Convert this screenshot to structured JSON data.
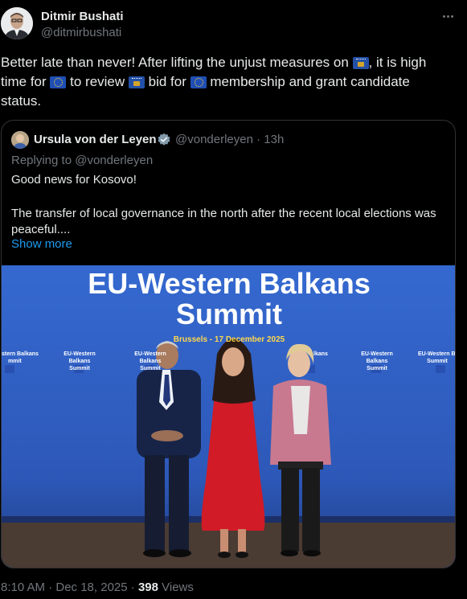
{
  "author": {
    "name": "Ditmir Bushati",
    "handle": "@ditmirbushati"
  },
  "tweet": {
    "part1": "Better late than never! After lifting the unjust measures on ",
    "part2": ", it is high time for ",
    "part3": " to review ",
    "part4": " bid for ",
    "part5": " membership and grant candidate status.",
    "flags": [
      "kosovo-flag",
      "eu-flag",
      "kosovo-flag",
      "eu-flag"
    ]
  },
  "quoted": {
    "name": "Ursula von der Leyen",
    "handle_time": "@vonderleyen · 13h",
    "replying": "Replying to @vonderleyen",
    "line1": "Good news for Kosovo!",
    "line2": "The transfer of local governance in the north after the recent local elections was peaceful....",
    "show_more": "Show more",
    "image": {
      "banner_title_1": "EU-Western Balkans",
      "banner_title_2": "Summit",
      "banner_subtitle": "Brussels - 17 December 2025",
      "panel_label_1": "EU-Western Balkans",
      "panel_label_2": "Summit",
      "edge_label_1": "stern Balkans",
      "edge_label_2": "mmit",
      "edge_label_3": "EU-Western Balka",
      "edge_label_4": "Summit",
      "center_label": "lkans"
    }
  },
  "footer": {
    "time": "8:10 AM · Dec 18, 2025 · ",
    "views_count": "398",
    "views_label": " Views"
  },
  "colors": {
    "background": "#000000",
    "text": "#e7e9ea",
    "muted": "#71767b",
    "link": "#1d9bf0",
    "stage_blue": "#2f5fc0"
  }
}
